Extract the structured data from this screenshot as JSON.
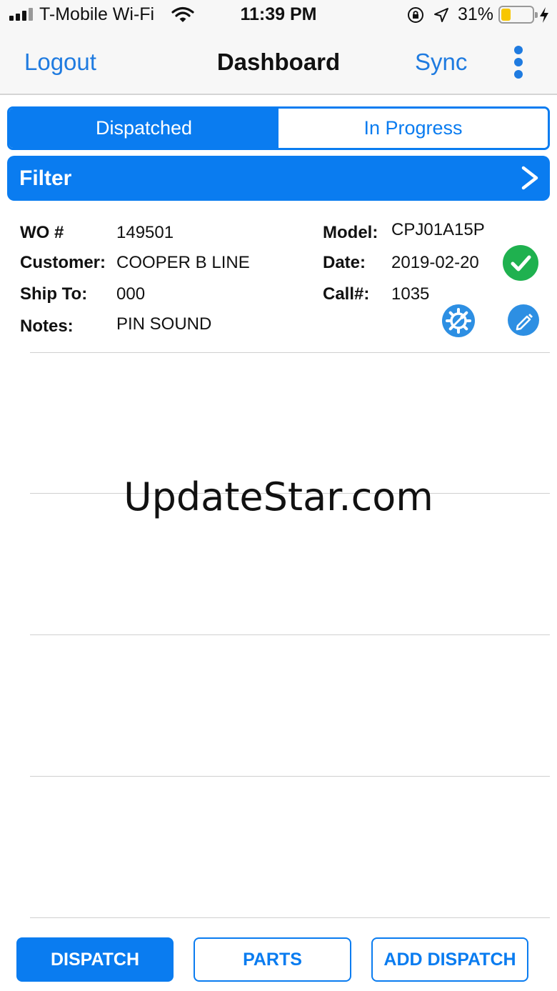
{
  "status_bar": {
    "carrier": "T-Mobile Wi-Fi",
    "time": "11:39 PM",
    "battery_percent": "31%",
    "battery_level": 0.31,
    "icons": [
      "signal-icon",
      "wifi-icon",
      "rotation-lock-icon",
      "location-icon",
      "battery-icon",
      "charging-icon"
    ]
  },
  "nav": {
    "logout_label": "Logout",
    "title": "Dashboard",
    "sync_label": "Sync",
    "more_icon": "more-vertical-icon"
  },
  "tabs": [
    {
      "label": "Dispatched",
      "selected": true
    },
    {
      "label": "In Progress",
      "selected": false
    }
  ],
  "filter": {
    "label": "Filter",
    "icon": "chevron-right-icon"
  },
  "work_order": {
    "wo_label": "WO #",
    "wo_value": "149501",
    "customer_label": "Customer:",
    "customer_value": "COOPER B LINE",
    "ship_to_label": "Ship To:",
    "ship_to_value": "000",
    "notes_label": "Notes:",
    "notes_value": "PIN SOUND",
    "model_label": "Model:",
    "model_value": "CPJ01A15P",
    "date_label": "Date:",
    "date_value": "2019-02-20",
    "call_label": "Call#:",
    "call_value": "1035",
    "status_icon": "check-circle-icon",
    "action_icons": [
      "settings-tools-icon",
      "edit-pencil-icon"
    ]
  },
  "watermark": "UpdateStar.com",
  "buttons": {
    "dispatch": "DISPATCH",
    "parts": "PARTS",
    "add_dispatch": "ADD DISPATCH"
  },
  "colors": {
    "accent": "#0a7cf0",
    "link": "#1f7be0",
    "success": "#1fb14f",
    "icon_blue": "#2d8fe3",
    "battery_fill": "#f7c600"
  }
}
